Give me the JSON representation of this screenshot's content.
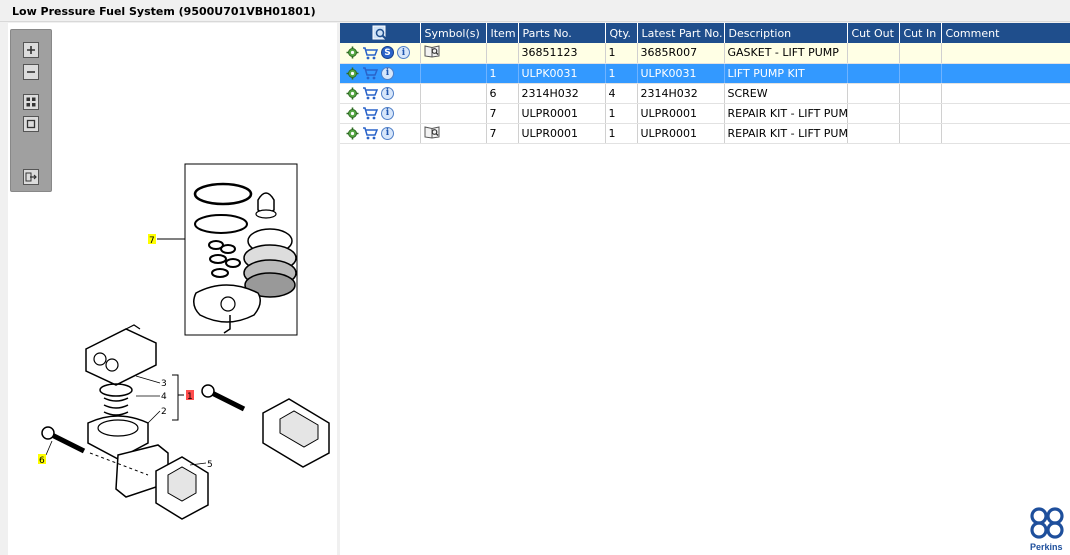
{
  "title": "Low Pressure Fuel System (9500U701VBH01801)",
  "toolbar_icons": [
    "zoom-in-icon",
    "zoom-out-icon",
    "fit-icon",
    "actual-size-icon",
    "export-icon"
  ],
  "diagram": {
    "callouts": {
      "item7": "7",
      "item1": "1",
      "item3": "3",
      "item4": "4",
      "item2": "2",
      "item6": "6",
      "item5": "5"
    },
    "highlight_colors": {
      "yellow": "#ffff00",
      "red": "#ff4d4d"
    }
  },
  "table": {
    "headers": {
      "symbols": "Symbol(s)",
      "item": "Item",
      "parts_no": "Parts No.",
      "qty": "Qty.",
      "latest_part_no": "Latest Part No.",
      "description": "Description",
      "cut_out": "Cut Out",
      "cut_in": "Cut In",
      "comment": "Comment"
    },
    "rows": [
      {
        "item": "",
        "parts_no": "36851123",
        "qty": "1",
        "latest_part_no": "3685R007",
        "description": "GASKET - LIFT PUMP",
        "cut_out": "",
        "cut_in": "",
        "comment": "",
        "has_s_icon": true,
        "has_book_icon": true,
        "s_label": "S",
        "info_label": "i"
      },
      {
        "item": "1",
        "parts_no": "ULPK0031",
        "qty": "1",
        "latest_part_no": "ULPK0031",
        "description": "LIFT PUMP KIT",
        "cut_out": "",
        "cut_in": "",
        "comment": "",
        "has_s_icon": false,
        "has_book_icon": false,
        "info_label": "i"
      },
      {
        "item": "6",
        "parts_no": "2314H032",
        "qty": "4",
        "latest_part_no": "2314H032",
        "description": "SCREW",
        "cut_out": "",
        "cut_in": "",
        "comment": "",
        "has_s_icon": false,
        "has_book_icon": false,
        "info_label": "i"
      },
      {
        "item": "7",
        "parts_no": "ULPR0001",
        "qty": "1",
        "latest_part_no": "ULPR0001",
        "description": "REPAIR KIT - LIFT PUMP",
        "cut_out": "",
        "cut_in": "",
        "comment": "",
        "has_s_icon": false,
        "has_book_icon": false,
        "info_label": "i"
      },
      {
        "item": "7",
        "parts_no": "ULPR0001",
        "qty": "1",
        "latest_part_no": "ULPR0001",
        "description": "REPAIR KIT - LIFT PUMP",
        "cut_out": "",
        "cut_in": "",
        "comment": "",
        "has_s_icon": false,
        "has_book_icon": true,
        "info_label": "i"
      }
    ],
    "selected_row_index": 1,
    "colors": {
      "header": "#1f4e8c",
      "selected": "#3399ff",
      "first_row": "#ffffe5"
    }
  },
  "brand": {
    "logo_text": "Perkins",
    "color": "#1e4f9c"
  }
}
